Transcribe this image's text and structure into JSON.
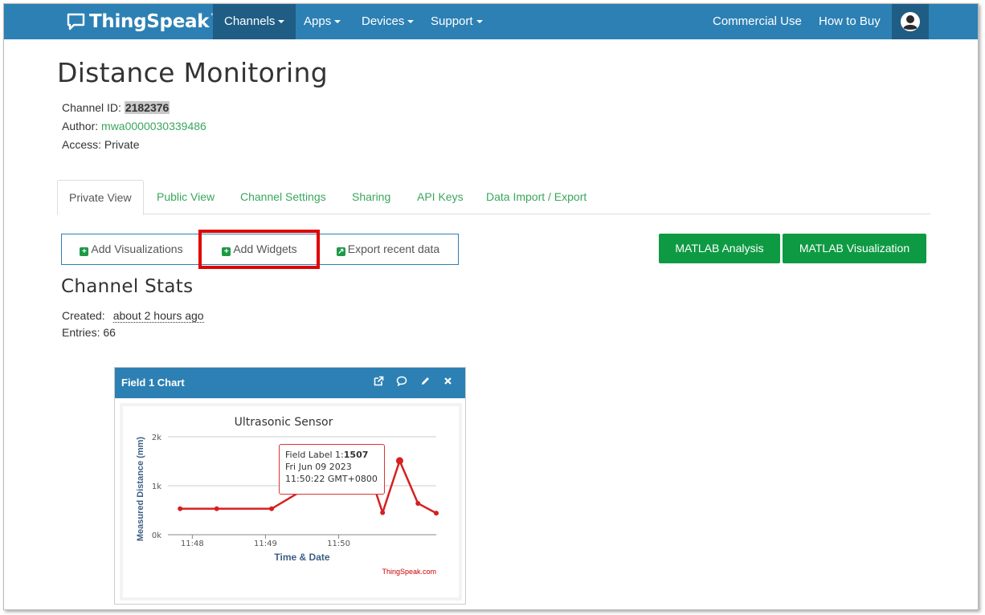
{
  "navbar": {
    "brand": "ThingSpeak",
    "tm": "™",
    "items": [
      {
        "label": "Channels"
      },
      {
        "label": "Apps"
      },
      {
        "label": "Devices"
      },
      {
        "label": "Support"
      }
    ],
    "right": [
      "Commercial Use",
      "How to Buy"
    ]
  },
  "channel": {
    "title": "Distance Monitoring",
    "id_label": "Channel ID: ",
    "id_value": "2182376",
    "author_label": "Author: ",
    "author_value": "mwa0000030339486",
    "access_label": "Access: ",
    "access_value": "Private"
  },
  "tabs": [
    "Private View",
    "Public View",
    "Channel Settings",
    "Sharing",
    "API Keys",
    "Data Import / Export"
  ],
  "buttons": {
    "add_visualizations": "Add Visualizations",
    "add_widgets": "Add Widgets",
    "export_recent": "Export recent data",
    "matlab_analysis": "MATLAB Analysis",
    "matlab_visualization": "MATLAB Visualization"
  },
  "stats": {
    "title": "Channel Stats",
    "created_label": "Created:",
    "created_value": "about 2 hours ago",
    "entries_label": "Entries: ",
    "entries_value": "66"
  },
  "widget": {
    "title": "Field 1 Chart"
  },
  "colors": {
    "nav": "#2c80b4",
    "nav_active": "#1f5d85",
    "green": "#0e9a43",
    "link": "#3aa65e",
    "highlight_box": "#e00000",
    "series": "#d62020"
  },
  "chart_data": {
    "type": "line",
    "title": "Ultrasonic Sensor",
    "xlabel": "Time & Date",
    "ylabel": "Measured Distance (mm)",
    "y_ticks": [
      "0k",
      "1k",
      "2k"
    ],
    "x_ticks": [
      "11:48",
      "11:49",
      "11:50"
    ],
    "ylim": [
      0,
      2000
    ],
    "credit": "ThingSpeak.com",
    "series": [
      {
        "x": [
          "11:47:50",
          "11:48:20",
          "11:49:05",
          "11:49:40",
          "11:50:22",
          "11:50:36",
          "11:50:50",
          "11:51:05",
          "11:51:20"
        ],
        "y": [
          530,
          530,
          530,
          1050,
          1507,
          450,
          1510,
          640,
          440
        ]
      }
    ],
    "tooltip": {
      "label": "Field Label 1:",
      "value": "1507",
      "date": "Fri Jun 09 2023",
      "time": "11:50:22 GMT+0800"
    },
    "grid": true
  }
}
